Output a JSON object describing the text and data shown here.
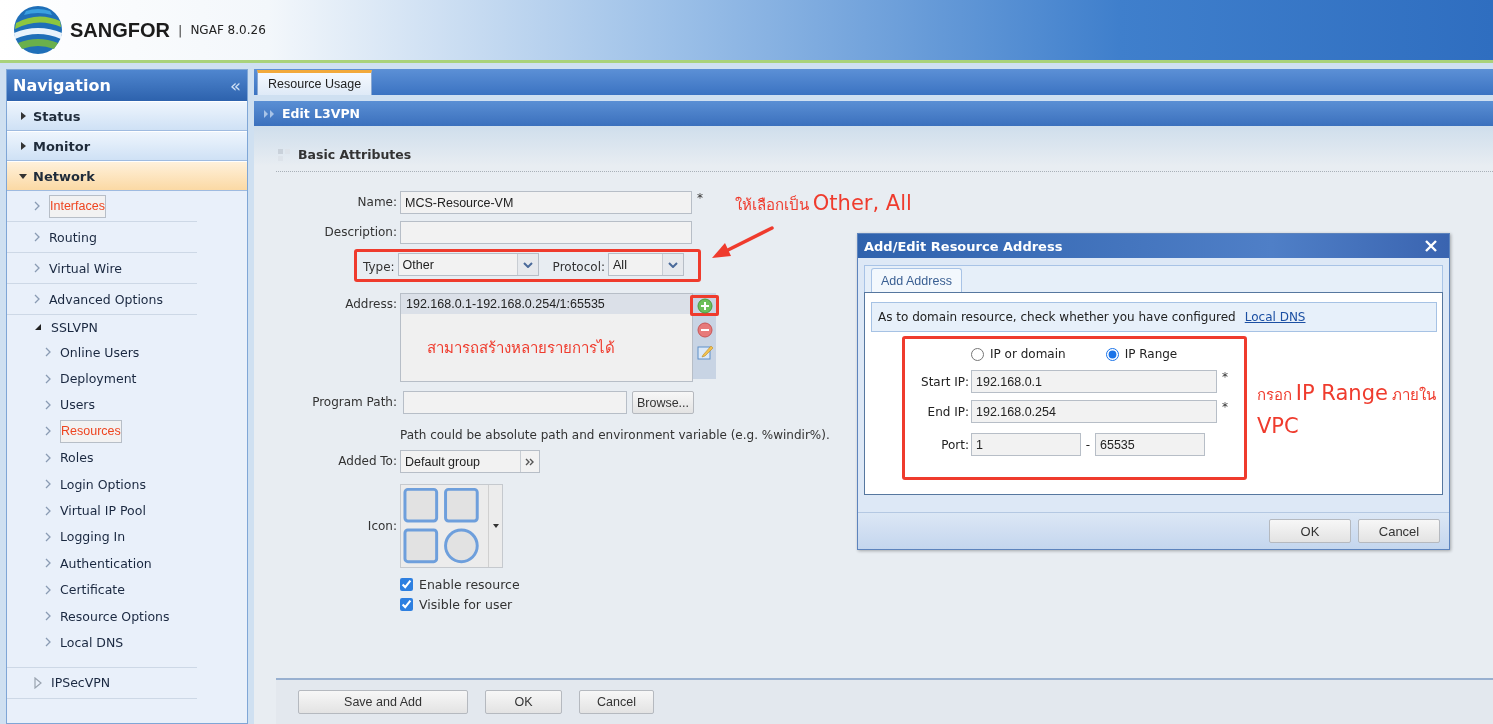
{
  "header": {
    "brand": "SANGFOR",
    "separator": "|",
    "product": "NGAF 8.0.26"
  },
  "navigation": {
    "title": "Navigation",
    "collapse": "«",
    "items": [
      {
        "label": "Status",
        "expanded": false
      },
      {
        "label": "Monitor",
        "expanded": false
      },
      {
        "label": "Network",
        "expanded": true,
        "children": [
          {
            "label": "Interfaces",
            "selected": true
          },
          {
            "label": "Routing",
            "selected": false
          },
          {
            "label": "Virtual Wire",
            "selected": false
          },
          {
            "label": "Advanced Options",
            "selected": false
          },
          {
            "label": "SSLVPN",
            "selected": false,
            "expanded": true,
            "children": [
              {
                "label": "Online Users",
                "selected": false
              },
              {
                "label": "Deployment",
                "selected": false
              },
              {
                "label": "Users",
                "selected": false
              },
              {
                "label": "Resources",
                "selected": true
              },
              {
                "label": "Roles",
                "selected": false
              },
              {
                "label": "Login Options",
                "selected": false
              },
              {
                "label": "Virtual IP Pool",
                "selected": false
              },
              {
                "label": "Logging In",
                "selected": false
              },
              {
                "label": "Authentication",
                "selected": false
              },
              {
                "label": "Certificate",
                "selected": false
              },
              {
                "label": "Resource Options",
                "selected": false
              },
              {
                "label": "Local DNS",
                "selected": false
              }
            ]
          },
          {
            "label": "IPSecVPN",
            "selected": false,
            "expanded": false
          }
        ]
      }
    ]
  },
  "tabs": [
    {
      "label": "Resource Usage",
      "selected": true
    }
  ],
  "page_title": "Edit L3VPN",
  "section_title": "Basic Attributes",
  "form": {
    "name": {
      "label": "Name:",
      "value": "MCS-Resource-VM",
      "required": "*"
    },
    "description": {
      "label": "Description:"
    },
    "type": {
      "label": "Type:",
      "value": "Other",
      "highlighted": true
    },
    "protocol": {
      "label": "Protocol:",
      "value": "All"
    },
    "address": {
      "label": "Address:",
      "entries": [
        {
          "text": "192.168.0.1-192.168.0.254/1:65535",
          "selected": true
        }
      ],
      "add_highlighted": true
    },
    "program_path": {
      "label": "Program Path:",
      "button": "Browse..."
    },
    "hint": "Path could be absolute path and environment variable (e.g. %windir%).",
    "added_to": {
      "label": "Added To:",
      "value": "Default group"
    },
    "icon": {
      "label": "Icon:"
    },
    "checkboxes": [
      {
        "label": "Enable resource",
        "checked": true
      },
      {
        "label": "Visible for user",
        "checked": true
      }
    ],
    "buttons": [
      "Save and Add",
      "OK",
      "Cancel"
    ]
  },
  "dialog": {
    "title": "Add/Edit Resource Address",
    "tabs": [
      {
        "label": "Add Address",
        "selected": true
      }
    ],
    "notice": {
      "text": "As to domain resource, check whether you have configured",
      "link": "Local DNS"
    },
    "highlighted": true,
    "modes": [
      {
        "label": "IP or domain",
        "selected": false
      },
      {
        "label": "IP Range",
        "selected": true
      }
    ],
    "fields": [
      {
        "label": "Start IP:",
        "value": "192.168.0.1",
        "required": "*"
      },
      {
        "label": "End IP:",
        "value": "192.168.0.254",
        "required": "*"
      }
    ],
    "port": {
      "label": "Port:",
      "from": "1",
      "separator": "-",
      "to": "65535"
    },
    "buttons": [
      "OK",
      "Cancel"
    ]
  },
  "annotations": [
    {
      "segments": [
        {
          "text": "ให้เลือกเป็น",
          "kind": "small"
        },
        {
          "text": "Other, All",
          "kind": "large"
        }
      ],
      "arrow": true
    },
    {
      "segments": [
        {
          "text": "สามารถสร้างหลายรายการได้",
          "kind": "small"
        }
      ],
      "arrow": false
    },
    {
      "segments": [
        {
          "text": "กรอก",
          "kind": "small"
        },
        {
          "text": "IP Range",
          "kind": "large"
        },
        {
          "text": "ภายใน",
          "kind": "small"
        },
        {
          "text": "VPC",
          "kind": "large"
        }
      ],
      "arrow": false
    }
  ]
}
